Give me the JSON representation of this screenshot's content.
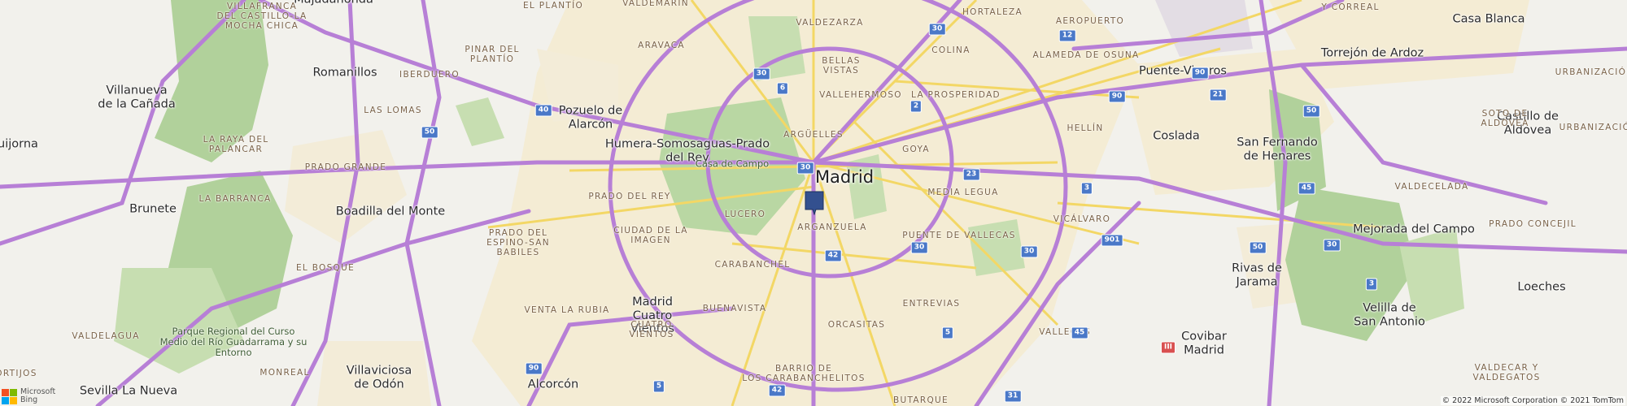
{
  "map": {
    "center_city": "Madrid",
    "towns": [
      "Majadahonda",
      "Romanillos",
      "Villanueva\nde la Cañada",
      "uijorna",
      "Brunete",
      "Boadilla del Monte",
      "Pozuelo de\nAlarcón",
      "Humera-Somosaguas-Prado\ndel Rey",
      "Villaviciosa\nde Odón",
      "Sevilla La Nueva",
      "Alcorcón",
      "Coslada",
      "San Fernando\nde Henares",
      "Puente-Viveros",
      "Torrejón de Ardoz",
      "Casa Blanca",
      "Castillo de\nAldovea",
      "Mejorada del Campo",
      "Rivas de\nJarama",
      "Velilla de\nSan Antonio",
      "Loeches",
      "Covibar\nMadrid",
      "Madrid\nCuatro\nVientos"
    ],
    "districts": [
      "Villafranca\ndel Castillo-la\nMocha Chica",
      "El Plantío",
      "Valdemarín",
      "Valdezarza",
      "Hortaleza",
      "Aeropuerto",
      "y Correal",
      "Pinar del\nPlantío",
      "Aravaca",
      "Iberduero",
      "Las Lomas",
      "Bellas\nVistas",
      "Colina",
      "Alameda de Osuna",
      "Vallehermoso",
      "La Prosperidad",
      "Argüelles",
      "Goya",
      "Hellín",
      "La Raya del\nPalancar",
      "Prado Grande",
      "Prado del Rey",
      "La Barranca",
      "Lucero",
      "Arganzuela",
      "Media Legua",
      "Vicálvaro",
      "Valdecelada",
      "Urbanización",
      "Urbanización",
      "Soto de\nAldovea",
      "Prado del\nEspino-San\nBabiles",
      "Ciudad de la\nImagen",
      "Puente de Vallecas",
      "Prado Concejil",
      "El Bosque",
      "Carabanchel",
      "Venta la Rubia",
      "Buenavista",
      "Cuatro\nVientos",
      "Orcasitas",
      "Entrevias",
      "Vallecas",
      "Valdelagua",
      "Ortijos",
      "Monreal",
      "Barrio de\nLos Carabanchelitos",
      "Butarque",
      "Valdecar y\nValdegatos"
    ],
    "parks": [
      "Casa de Campo",
      "Parque Regional del Curso\nMedio del Río Guadarrama y su\nEntorno"
    ],
    "road_shields": [
      "30",
      "12",
      "30",
      "6",
      "40",
      "50",
      "30",
      "2",
      "90",
      "90",
      "21",
      "50",
      "30",
      "23",
      "3",
      "45",
      "30",
      "42",
      "30",
      "901",
      "50",
      "3",
      "5",
      "45",
      "III",
      "90",
      "5",
      "42",
      "31"
    ],
    "attribution": {
      "logo_top": "Microsoft",
      "logo_bottom": "Bing",
      "copyright": "© 2022 Microsoft Corporation © 2021 TomTom"
    },
    "colors": {
      "background": "#f2f1ec",
      "urban": "#f4ecd4",
      "park": "#c7deb1",
      "forest": "#b1d19b",
      "highway": "#b77fd6",
      "major_road": "#f3d765",
      "pin": "#33508f",
      "ms_red": "#f25022",
      "ms_green": "#7fba00",
      "ms_blue": "#00a4ef",
      "ms_yellow": "#ffb900"
    },
    "pin_icon": "map-pin-icon"
  }
}
